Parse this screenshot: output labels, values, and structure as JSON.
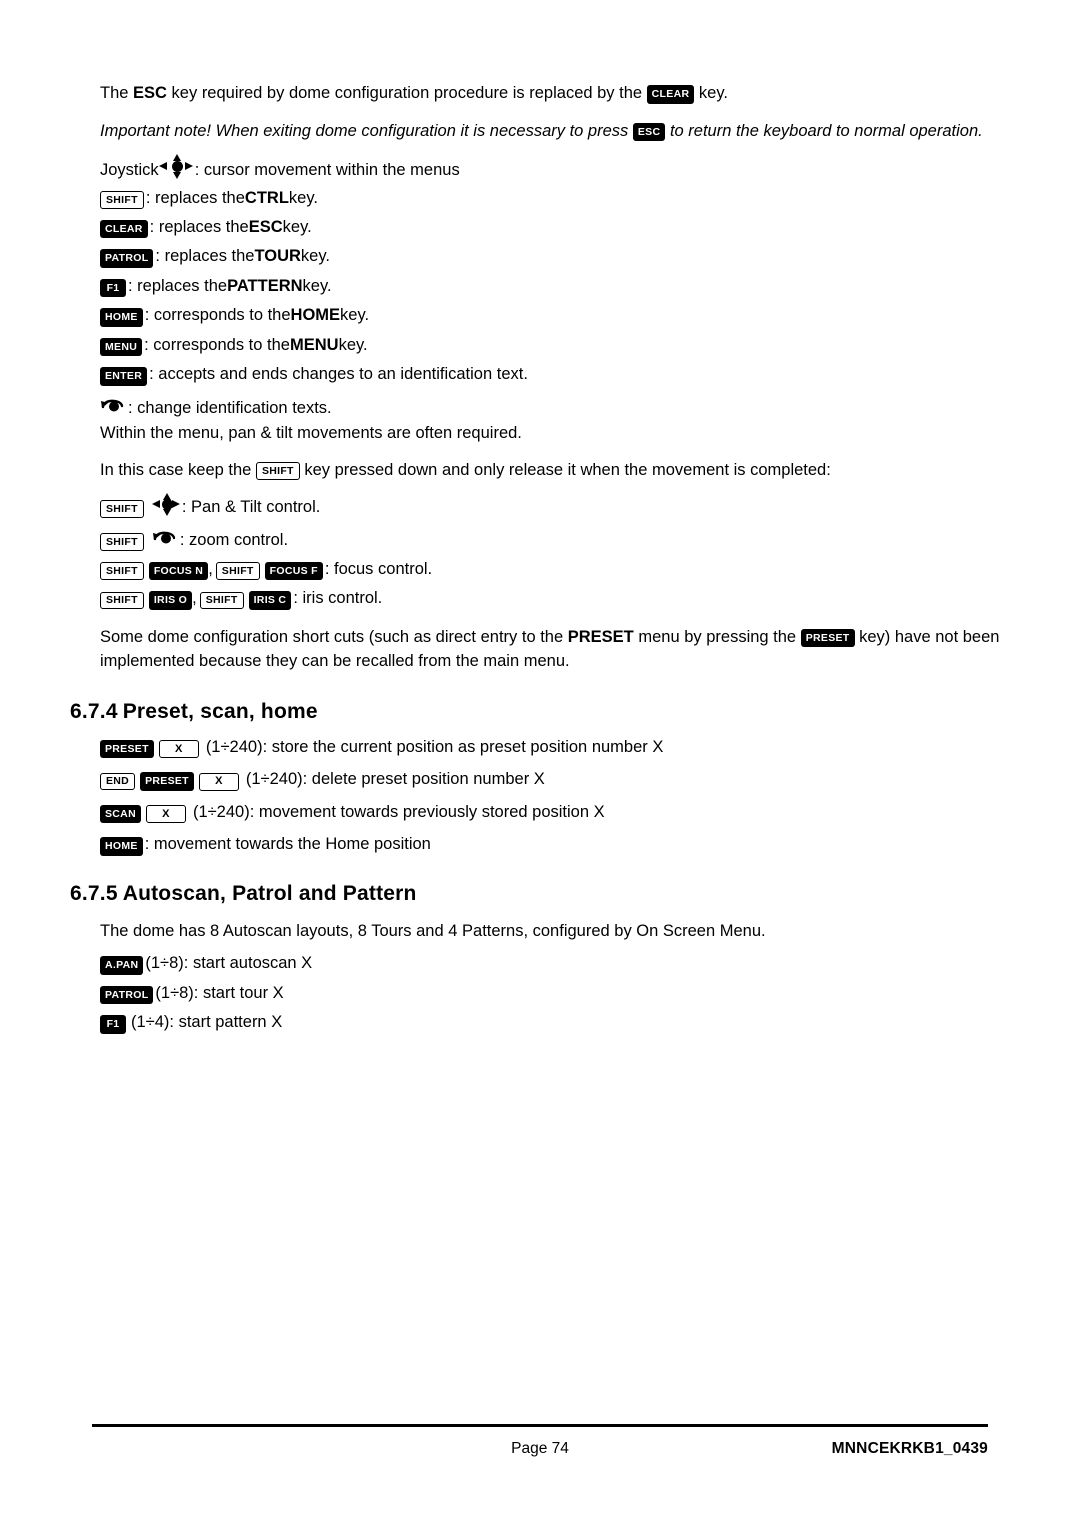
{
  "document": {
    "intro": {
      "esc_sentence_pre": "The ",
      "esc_bold": "ESC",
      "esc_sentence_mid": " key required by dome configuration procedure is replaced by the ",
      "clear_key": "CLEAR",
      "esc_sentence_post": " key.",
      "note_pre": "Important note! When exiting dome configuration it is necessary to press ",
      "note_key": "ESC",
      "note_post": " to return the keyboard to normal operation."
    },
    "joystick_line": {
      "label": "Joystick ",
      "text": ": cursor movement within the menus"
    },
    "key_list": [
      {
        "key": "SHIFT",
        "text_pre": ": replaces the ",
        "bold": "CTRL",
        "text_post": " key."
      },
      {
        "key": "CLEAR",
        "text_pre": ": replaces the ",
        "bold": "ESC",
        "text_post": " key."
      },
      {
        "key": "PATROL",
        "text_pre": ": replaces the ",
        "bold": "TOUR",
        "text_post": " key."
      },
      {
        "key": "F1",
        "text_pre": ": replaces the ",
        "bold": "PATTERN",
        "text_post": " key."
      },
      {
        "key": "HOME",
        "text_pre": ": corresponds to the ",
        "bold": "HOME",
        "text_post": " key."
      },
      {
        "key": "MENU",
        "text_pre": ": corresponds to the ",
        "bold": "MENU",
        "text_post": " key."
      },
      {
        "key": "ENTER",
        "text_pre": ": accepts and ends changes to an identification text.",
        "bold": "",
        "text_post": ""
      }
    ],
    "zoom_change_line": ": change identification texts.",
    "within_menu_line": "Within the menu, pan & tilt movements are often required.",
    "keep_shift_pre": "In this case keep the ",
    "keep_shift_key": "SHIFT",
    "keep_shift_post": " key pressed down and only release it when the movement is completed:",
    "shift_combos": [
      {
        "keys": [
          "SHIFT"
        ],
        "icon": "joystick",
        "text": ": Pan & Tilt control."
      },
      {
        "keys": [
          "SHIFT"
        ],
        "icon": "zoom",
        "text": ": zoom control."
      },
      {
        "keys": [
          "SHIFT",
          "FOCUS N"
        ],
        "sep": ", ",
        "keys2": [
          "SHIFT",
          "FOCUS F"
        ],
        "text": ": focus control."
      },
      {
        "keys": [
          "SHIFT",
          "IRIS O"
        ],
        "sep": ", ",
        "keys2": [
          "SHIFT",
          "IRIS C"
        ],
        "text": ": iris control."
      }
    ],
    "shortcuts_para": {
      "pre": "Some dome configuration short cuts (such as direct entry to the ",
      "bold": "PRESET",
      "mid": " menu by pressing the ",
      "key": "PRESET",
      "post": " key) have not been implemented because they can be recalled from the main menu."
    },
    "section_674": {
      "number": "6.7.4",
      "title": "Preset, scan, home",
      "items": [
        {
          "keys": [
            "PRESET",
            "X"
          ],
          "text": "(1÷240): store the current position as preset position number X"
        },
        {
          "keys": [
            "END",
            "PRESET",
            "X"
          ],
          "text": "(1÷240): delete preset position number X"
        },
        {
          "keys": [
            "SCAN",
            "X"
          ],
          "text": "(1÷240): movement towards previously stored position X"
        },
        {
          "keys": [
            "HOME"
          ],
          "text": ": movement towards the Home position"
        }
      ]
    },
    "section_675": {
      "number": "6.7.5",
      "title": "Autoscan, Patrol and Pattern",
      "intro": "The dome has 8 Autoscan layouts, 8 Tours and 4 Patterns, configured by On Screen Menu.",
      "items": [
        {
          "key": "A.PAN",
          "text": "(1÷8): start autoscan X"
        },
        {
          "key": "PATROL",
          "text": "(1÷8): start tour X"
        },
        {
          "key": "F1",
          "text": "(1÷4): start pattern X"
        }
      ]
    },
    "footer": {
      "page": "Page 74",
      "doc_id": "MNNCEKRKB1_0439"
    }
  }
}
